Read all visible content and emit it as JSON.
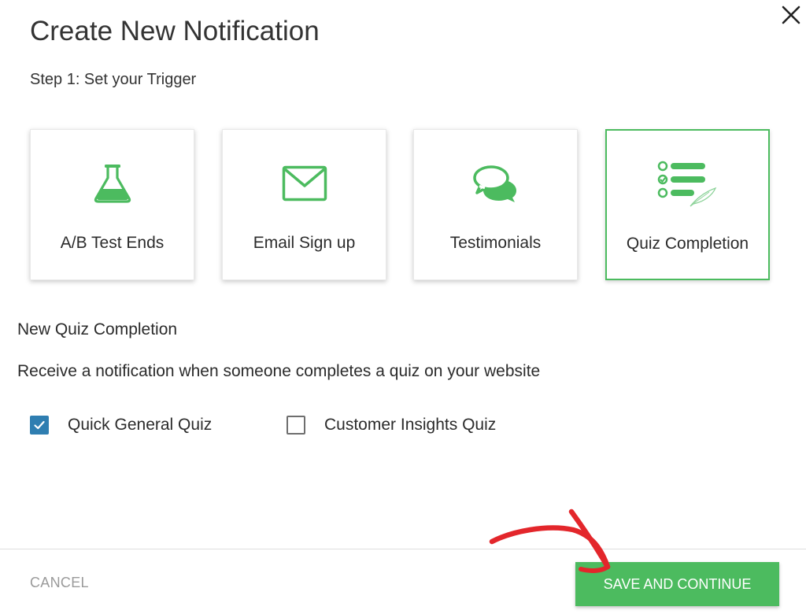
{
  "dialog": {
    "title": "Create New Notification",
    "step_label": "Step 1: Set your Trigger"
  },
  "triggers": [
    {
      "label": "A/B Test Ends",
      "icon": "flask-icon",
      "selected": false
    },
    {
      "label": "Email Sign up",
      "icon": "envelope-icon",
      "selected": false
    },
    {
      "label": "Testimonials",
      "icon": "speech-bubbles-icon",
      "selected": false
    },
    {
      "label": "Quiz Completion",
      "icon": "checklist-icon",
      "selected": true
    }
  ],
  "section": {
    "title": "New Quiz Completion",
    "description": "Receive a notification when someone completes a quiz on your website"
  },
  "quizzes": [
    {
      "label": "Quick General Quiz",
      "checked": true
    },
    {
      "label": "Customer Insights Quiz",
      "checked": false
    }
  ],
  "footer": {
    "cancel_label": "CANCEL",
    "save_label": "SAVE AND CONTINUE"
  },
  "colors": {
    "accent_green": "#4cbb5f",
    "checkbox_blue": "#2f7eb1",
    "annotation_red": "#e3262b"
  }
}
